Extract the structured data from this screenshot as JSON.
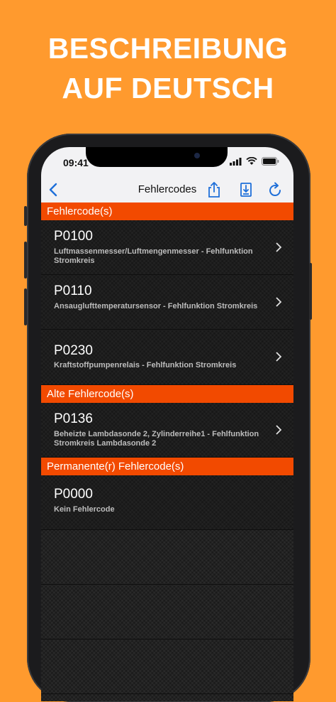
{
  "headline": {
    "line1": "BESCHREIBUNG",
    "line2": "AUF DEUTSCH"
  },
  "status": {
    "time": "09:41"
  },
  "nav": {
    "title": "Fehlercodes"
  },
  "sections": [
    {
      "title": "Fehlercode(s)",
      "items": [
        {
          "code": "P0100",
          "desc": "Luftmassenmesser/Luftmengenmesser - Fehlfunktion Stromkreis"
        },
        {
          "code": "P0110",
          "desc": "Ansauglufttemperatursensor - Fehlfunktion Stromkreis"
        },
        {
          "code": "P0230",
          "desc": "Kraftstoffpumpenrelais - Fehlfunktion Stromkreis"
        }
      ]
    },
    {
      "title": "Alte Fehlercode(s)",
      "items": [
        {
          "code": "P0136",
          "desc": "Beheizte Lambdasonde 2, Zylinderreihe1 - Fehlfunktion Stromkreis Lambdasonde 2"
        }
      ]
    },
    {
      "title": "Permanente(r) Fehlercode(s)",
      "items": [
        {
          "code": "P0000",
          "desc": "Kein Fehlercode"
        }
      ]
    }
  ],
  "colors": {
    "background": "#ff9a2e",
    "section_header": "#f24a00",
    "accent_blue": "#1e6fd9"
  }
}
